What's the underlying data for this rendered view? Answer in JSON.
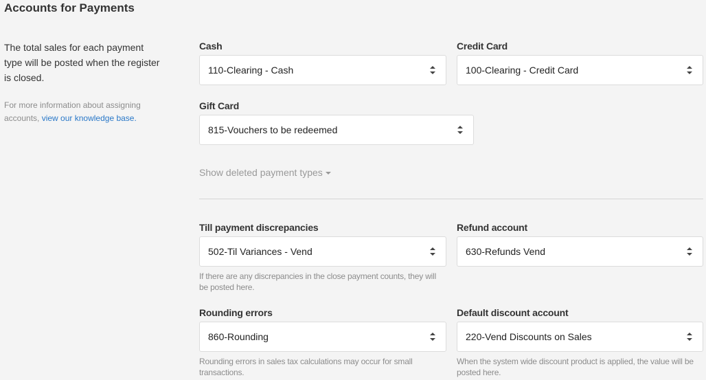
{
  "page": {
    "title": "Accounts for Payments",
    "description": "The total sales for each payment type will be posted when the register is closed.",
    "info_prefix": "For more information about assigning accounts,",
    "info_link": "view our knowledge base."
  },
  "payment_types": {
    "cash": {
      "label": "Cash",
      "value": "110-Clearing - Cash"
    },
    "credit_card": {
      "label": "Credit Card",
      "value": "100-Clearing - Credit Card"
    },
    "gift_card": {
      "label": "Gift Card",
      "value": "815-Vouchers to be redeemed"
    }
  },
  "show_deleted": {
    "label": "Show deleted payment types",
    "icon": "caret-down-icon"
  },
  "accounts": {
    "till": {
      "label": "Till payment discrepancies",
      "value": "502-Til Variances - Vend",
      "hint": "If there are any discrepancies in the close payment counts, they will be posted here."
    },
    "refund": {
      "label": "Refund account",
      "value": "630-Refunds Vend"
    },
    "rounding": {
      "label": "Rounding errors",
      "value": "860-Rounding",
      "hint": "Rounding errors in sales tax calculations may occur for small transactions."
    },
    "discount": {
      "label": "Default discount account",
      "value": "220-Vend Discounts on Sales",
      "hint": "When the system wide discount product is applied, the value will be posted here."
    }
  },
  "colors": {
    "background": "#f4f4f4",
    "link": "#2a78c8",
    "muted_text": "#8c8c8c",
    "select_border": "#dcdcdc"
  }
}
